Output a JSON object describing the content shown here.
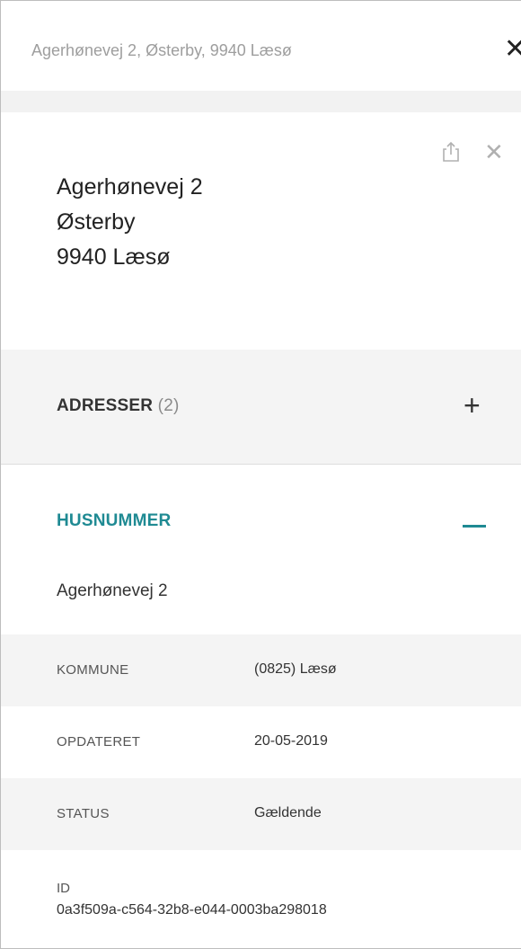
{
  "search": {
    "value": "Agerhønevej 2, Østerby, 9940 Læsø"
  },
  "card": {
    "address_lines": [
      "Agerhønevej 2",
      "Østerby",
      "9940 Læsø"
    ]
  },
  "adresser": {
    "title": "ADRESSER",
    "count": "(2)",
    "expand_symbol": "+"
  },
  "husnummer": {
    "title": "HUSNUMMER",
    "name": "Agerhønevej 2",
    "rows": [
      {
        "label": "KOMMUNE",
        "value": "(0825) Læsø"
      },
      {
        "label": "OPDATERET",
        "value": "20-05-2019"
      },
      {
        "label": "STATUS",
        "value": "Gældende"
      }
    ],
    "id_label": "ID",
    "id_value": "0a3f509a-c564-32b8-e044-0003ba298018"
  },
  "icons": {
    "search_close": "close-icon",
    "share": "share-icon",
    "card_close": "close-icon",
    "expand": "plus-icon",
    "collapse": "minus-icon"
  },
  "colors": {
    "accent": "#1f8a93",
    "muted_text": "#9e9e9e",
    "section_bg": "#f4f4f4"
  }
}
